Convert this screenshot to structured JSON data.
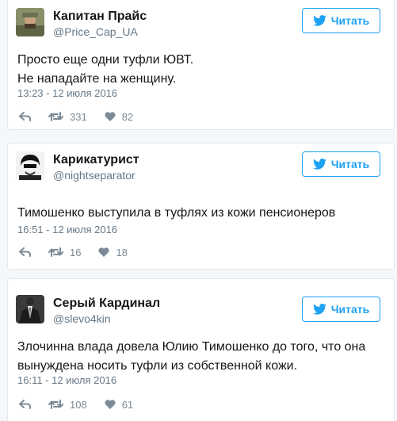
{
  "follow_label": "Читать",
  "colors": {
    "accent": "#1da1f2",
    "muted": "#657786",
    "icon": "#7b8a96"
  },
  "tweets": [
    {
      "name": "Капитан Прайс",
      "handle": "@Price_Cap_UA",
      "avatar": "military-portrait",
      "text_lines": [
        "Просто еще одни туфли ЮВТ.",
        "Не нападайте на женщину."
      ],
      "time": "13:23 - 12 июля 2016",
      "retweets": "331",
      "likes": "82"
    },
    {
      "name": "Карикатурист",
      "handle": "@nightseparator",
      "avatar": "sketch-face",
      "text_lines": [
        "Тимошенко выступила в туфлях из кожи пенсионеров"
      ],
      "time": "16:51 - 12 июля 2016",
      "retweets": "16",
      "likes": "18"
    },
    {
      "name": "Серый Кардинал",
      "handle": "@slevo4kin",
      "avatar": "suit-silhouette",
      "text_lines": [
        "Злочинна влада довела Юлию Тимошенко до того, что она",
        "вынуждена носить туфли из собственной кожи."
      ],
      "time": "16:11 - 12 июля 2016",
      "retweets": "108",
      "likes": "61"
    }
  ]
}
